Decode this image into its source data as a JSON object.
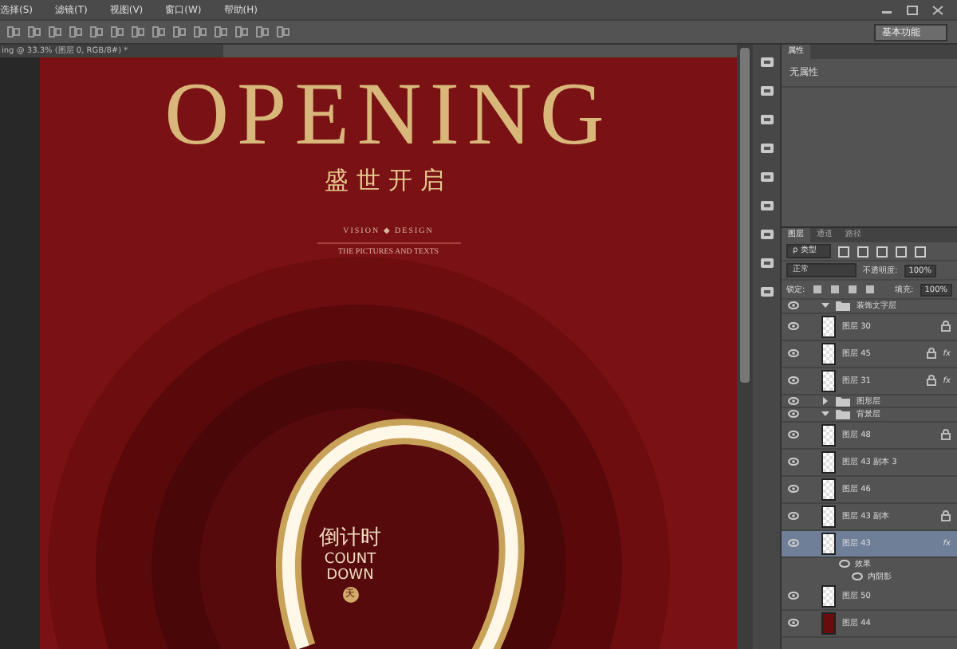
{
  "menu": [
    "选择(S)",
    "滤镜(T)",
    "视图(V)",
    "窗口(W)",
    "帮助(H)"
  ],
  "workspace": "基本功能",
  "document_tab": "ing @ 33.3% (图层 0, RGB/8#) *",
  "poster": {
    "title": "OPENING",
    "subtitle": "盛世开启",
    "tagline": "VISION ◆ DESIGN",
    "small_text": "THE PICTURES AND TEXTS",
    "badge_title": "倒计时",
    "badge_count": "COUNT",
    "badge_down": "DOWN",
    "badge_unit": "天"
  },
  "properties": {
    "tab": "属性",
    "text": "无属性"
  },
  "layers_panel": {
    "tabs": [
      {
        "label": "图层",
        "selected": true
      },
      {
        "label": "通道",
        "selected": false
      },
      {
        "label": "路径",
        "selected": false
      }
    ],
    "filter": "ρ 类型",
    "blend_mode": "正常",
    "opacity_label": "不透明度:",
    "opacity": "100%",
    "lock_label": "锁定:",
    "fill_label": "填充:",
    "fill": "100%",
    "layers": [
      {
        "kind": "group",
        "name": "装饰文字层",
        "expanded": true,
        "children": [
          {
            "kind": "layer",
            "name": "图层 30",
            "locked": true,
            "selected": false
          },
          {
            "kind": "layer",
            "name": "图层 45",
            "locked": true,
            "fx": "fx",
            "selected": false
          },
          {
            "kind": "layer",
            "name": "图层 31",
            "locked": true,
            "fx": "fx",
            "selected": false
          }
        ]
      },
      {
        "kind": "group",
        "name": "图形层",
        "expanded": false
      },
      {
        "kind": "group",
        "name": "背景层",
        "expanded": true,
        "children": [
          {
            "kind": "layer",
            "name": "图层 48",
            "locked": true,
            "selected": false
          },
          {
            "kind": "layer",
            "name": "图层 43 副本 3",
            "locked": false,
            "selected": false
          },
          {
            "kind": "layer",
            "name": "图层 46",
            "locked": false,
            "selected": false
          },
          {
            "kind": "layer",
            "name": "图层 43 副本",
            "locked": true,
            "selected": false
          },
          {
            "kind": "layer",
            "name": "图层 43",
            "locked": false,
            "fx": "fx",
            "selected": true,
            "effects": [
              "效果",
              "内阴影"
            ]
          },
          {
            "kind": "layer",
            "name": "图层 50",
            "locked": false,
            "selected": false
          },
          {
            "kind": "fill",
            "name": "图层 44",
            "locked": false,
            "selected": false
          }
        ]
      }
    ]
  }
}
